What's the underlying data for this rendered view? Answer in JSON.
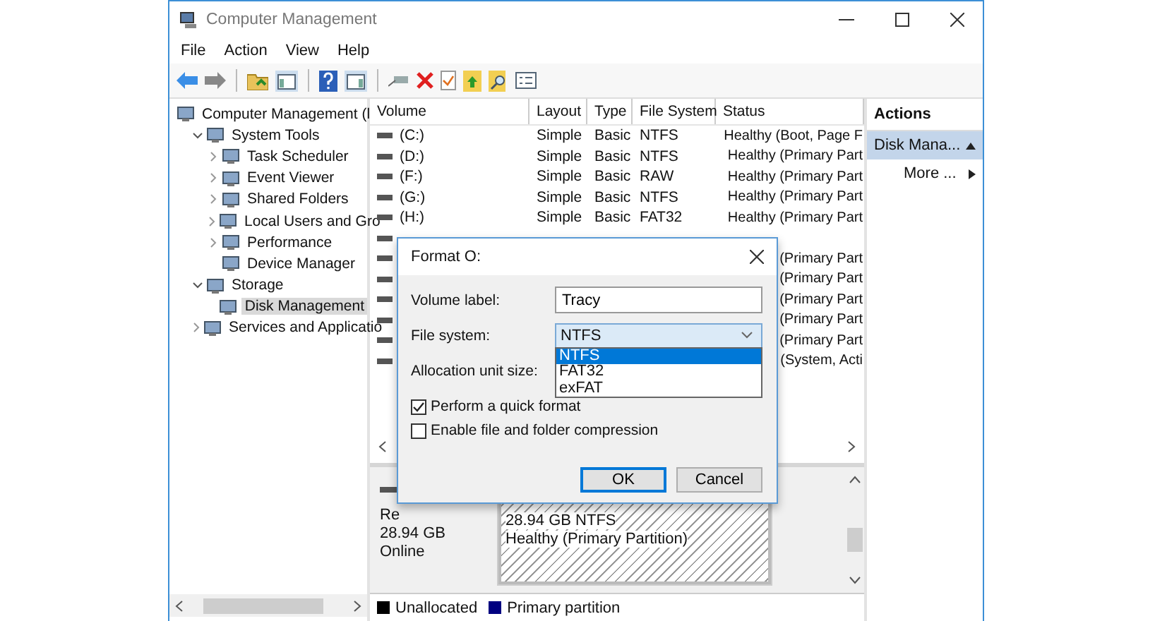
{
  "window": {
    "title": "Computer Management"
  },
  "menu": [
    "File",
    "Action",
    "View",
    "Help"
  ],
  "tree": [
    {
      "label": "Computer Management (l",
      "selected": false,
      "children": [
        {
          "label": "System Tools",
          "expanded": true,
          "selected": false,
          "children": [
            {
              "label": "Task Scheduler",
              "expanded": false,
              "selected": false
            },
            {
              "label": "Event Viewer",
              "expanded": false,
              "selected": false
            },
            {
              "label": "Shared Folders",
              "expanded": false,
              "selected": false
            },
            {
              "label": "Local Users and Gro",
              "expanded": false,
              "selected": false
            },
            {
              "label": "Performance",
              "expanded": false,
              "selected": false
            },
            {
              "label": "Device Manager",
              "selected": false
            }
          ]
        },
        {
          "label": "Storage",
          "expanded": true,
          "selected": false,
          "children": [
            {
              "label": "Disk Management",
              "selected": true
            }
          ]
        },
        {
          "label": "Services and Applicatio",
          "expanded": false,
          "selected": false
        }
      ]
    }
  ],
  "volumes": {
    "columns": [
      "Volume",
      "Layout",
      "Type",
      "File System",
      "Status"
    ],
    "rows": [
      {
        "volume": "(C:)",
        "layout": "Simple",
        "type": "Basic",
        "file_system": "NTFS",
        "status": "Healthy (Boot, Page F"
      },
      {
        "volume": "(D:)",
        "layout": "Simple",
        "type": "Basic",
        "file_system": "NTFS",
        "status": "Healthy (Primary Part"
      },
      {
        "volume": "(F:)",
        "layout": "Simple",
        "type": "Basic",
        "file_system": "RAW",
        "status": "Healthy (Primary Part"
      },
      {
        "volume": "(G:)",
        "layout": "Simple",
        "type": "Basic",
        "file_system": "NTFS",
        "status": "Healthy (Primary Part"
      },
      {
        "volume": "(H:)",
        "layout": "Simple",
        "type": "Basic",
        "file_system": "FAT32",
        "status": "Healthy (Primary Part"
      },
      {},
      {
        "status": "(Primary Part"
      },
      {
        "status": "(Primary Part"
      },
      {
        "status": "(Primary Part"
      },
      {
        "status": "(Primary Part"
      },
      {
        "status": "(Primary Part"
      },
      {
        "status": "(System, Acti"
      }
    ]
  },
  "disk": {
    "info": [
      "Re",
      "28.94 GB",
      "Online"
    ],
    "partition": {
      "size": "28.94 GB NTFS",
      "status": "Healthy (Primary Partition)"
    }
  },
  "legend": [
    {
      "label": "Unallocated",
      "color": "#000000"
    },
    {
      "label": "Primary partition",
      "color": "#000080"
    }
  ],
  "actions": {
    "header": "Actions",
    "items": [
      {
        "label": "Disk Mana...",
        "kind": "group",
        "selected": true
      },
      {
        "label": "More ...",
        "kind": "submenu",
        "selected": false
      }
    ]
  },
  "dialog": {
    "title": "Format O:",
    "fields": [
      {
        "label": "Volume label:",
        "kind": "text",
        "value": "Tracy"
      },
      {
        "label": "File system:",
        "kind": "select",
        "value": "NTFS",
        "expanded": true,
        "options": [
          {
            "label": "NTFS",
            "selected": true
          },
          {
            "label": "FAT32",
            "selected": false
          },
          {
            "label": "exFAT",
            "selected": false
          }
        ]
      },
      {
        "label": "Allocation unit size:",
        "kind": "covered"
      }
    ],
    "checkboxes": [
      {
        "label": "Perform a quick format",
        "checked": true
      },
      {
        "label": "Enable file and folder compression",
        "checked": false
      }
    ],
    "buttons": [
      {
        "label": "OK",
        "default": true
      },
      {
        "label": "Cancel",
        "default": false
      }
    ]
  }
}
